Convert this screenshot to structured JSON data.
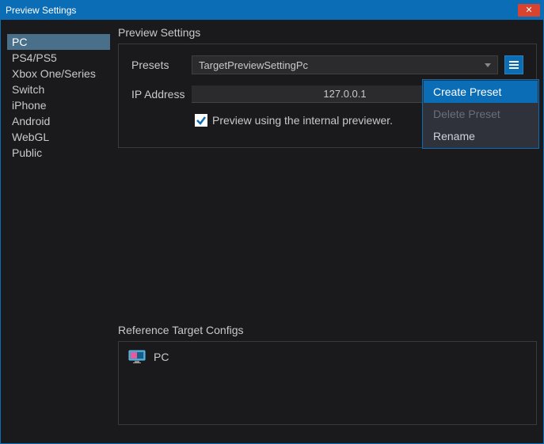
{
  "window": {
    "title": "Preview Settings"
  },
  "sidebar": {
    "items": [
      {
        "label": "PC",
        "selected": true
      },
      {
        "label": "PS4/PS5",
        "selected": false
      },
      {
        "label": "Xbox One/Series",
        "selected": false
      },
      {
        "label": "Switch",
        "selected": false
      },
      {
        "label": "iPhone",
        "selected": false
      },
      {
        "label": "Android",
        "selected": false
      },
      {
        "label": "WebGL",
        "selected": false
      },
      {
        "label": "Public",
        "selected": false
      }
    ]
  },
  "main": {
    "title": "Preview Settings",
    "presets_label": "Presets",
    "presets_value": "TargetPreviewSettingPc",
    "ip_label": "IP Address",
    "ip_value": "127.0.0.1",
    "checkbox_checked": true,
    "checkbox_label": "Preview using the internal previewer.",
    "ref_title": "Reference Target Configs",
    "ref_items": [
      {
        "label": "PC"
      }
    ]
  },
  "context_menu": {
    "items": [
      {
        "label": "Create Preset",
        "state": "highlight"
      },
      {
        "label": "Delete Preset",
        "state": "disabled"
      },
      {
        "label": "Rename",
        "state": "normal"
      }
    ]
  }
}
